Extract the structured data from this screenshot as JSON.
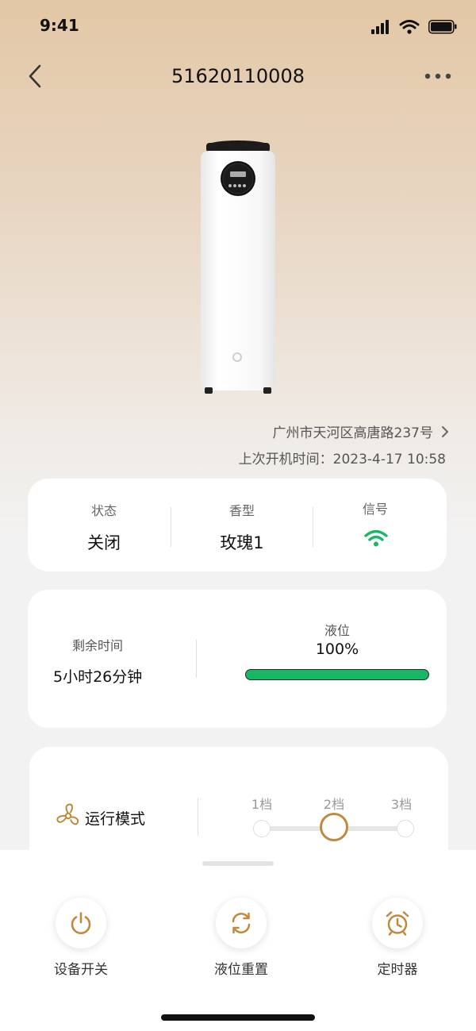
{
  "status_bar": {
    "time": "9:41"
  },
  "nav": {
    "title": "51620110008"
  },
  "device_info": {
    "address": "广州市天河区高唐路237号",
    "last_on": "上次开机时间：2023-4-17 10:58"
  },
  "info_card": {
    "status_label": "状态",
    "status_value": "关闭",
    "scent_label": "香型",
    "scent_value": "玫瑰1",
    "signal_label": "信号"
  },
  "level_card": {
    "remaining_label": "剩余时间",
    "remaining_value": "5小时26分钟",
    "liquid_label": "液位",
    "liquid_value": "100%",
    "liquid_fraction": 1.0
  },
  "mode_card": {
    "label": "运行模式",
    "gears": [
      "1档",
      "2档",
      "3档"
    ],
    "selected_gear_index": 1
  },
  "actions": [
    {
      "label": "设备开关",
      "icon": "power-icon"
    },
    {
      "label": "液位重置",
      "icon": "refresh-icon"
    },
    {
      "label": "定时器",
      "icon": "alarm-clock-icon"
    }
  ],
  "colors": {
    "accent": "#c0893b",
    "progress": "#17b766",
    "signal": "#17b766"
  }
}
